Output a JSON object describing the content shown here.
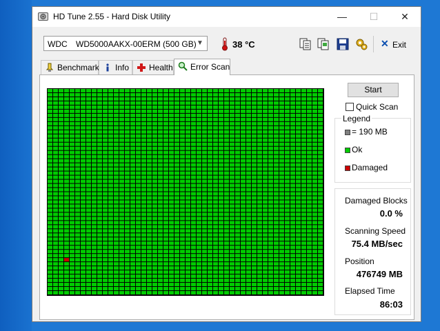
{
  "window": {
    "title": "HD Tune 2.55 - Hard Disk Utility"
  },
  "titlebar_buttons": {
    "minimize": "—",
    "maximize": "☐",
    "close": "✕"
  },
  "drive": {
    "brand": "WDC",
    "model": "WD5000AAKX-00ERM (500 GB)"
  },
  "temperature": "38 °C",
  "toolbar": {
    "tools": [
      "copy-info-icon",
      "copy-screenshot-icon",
      "save-icon",
      "options-icon"
    ],
    "exit_label": "Exit"
  },
  "tabs": [
    {
      "label": "Benchmark",
      "icon": "benchmark-icon"
    },
    {
      "label": "Info",
      "icon": "info-icon"
    },
    {
      "label": "Health",
      "icon": "health-icon"
    },
    {
      "label": "Error Scan",
      "icon": "magnifier-icon",
      "active": true
    }
  ],
  "scan": {
    "start_label": "Start",
    "quick_scan_label": "Quick Scan",
    "quick_scan_checked": false,
    "legend_title": "Legend",
    "legend": [
      {
        "label": "= 190 MB",
        "color": "#808080"
      },
      {
        "label": "Ok",
        "color": "#00cc00"
      },
      {
        "label": "Damaged",
        "color": "#cc0000"
      }
    ],
    "stats": [
      {
        "label": "Damaged Blocks",
        "value": "0.0 %"
      },
      {
        "label": "Scanning Speed",
        "value": "75.4 MB/sec"
      },
      {
        "label": "Position",
        "value": "476749 MB"
      },
      {
        "label": "Elapsed Time",
        "value": "86:03"
      }
    ],
    "grid": {
      "columns": 50,
      "rows": 50,
      "ok_color": "#00cc00",
      "damaged_color": "#cc0000",
      "damaged_blocks": [
        [
          3,
          41
        ]
      ]
    }
  }
}
